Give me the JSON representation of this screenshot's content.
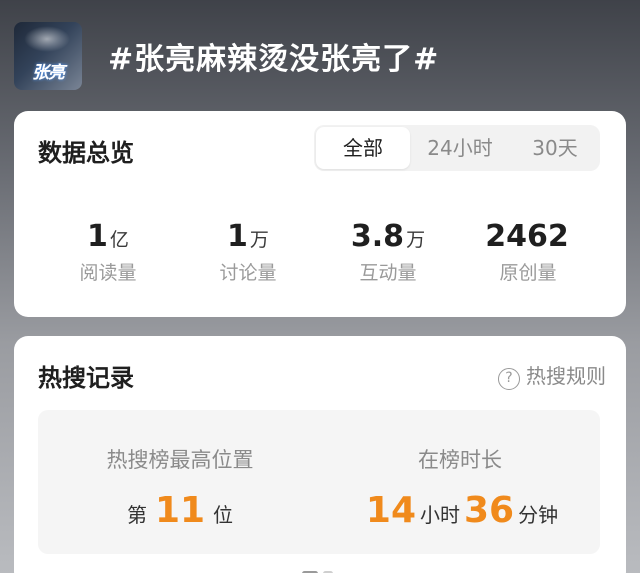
{
  "header": {
    "thumbnail_text": "张亮",
    "topic_title": "#张亮麻辣烫没张亮了#"
  },
  "overview": {
    "title": "数据总览",
    "tabs": [
      {
        "label": "全部",
        "active": true
      },
      {
        "label": "24小时",
        "active": false
      },
      {
        "label": "30天",
        "active": false
      }
    ],
    "stats": [
      {
        "value": "1",
        "unit": "亿",
        "label": "阅读量"
      },
      {
        "value": "1",
        "unit": "万",
        "label": "讨论量"
      },
      {
        "value": "3.8",
        "unit": "万",
        "label": "互动量"
      },
      {
        "value": "2462",
        "unit": "",
        "label": "原创量"
      }
    ]
  },
  "hot_search": {
    "title": "热搜记录",
    "rules_label": "热搜规则",
    "rules_icon": "question-circle-icon",
    "peak": {
      "label": "热搜榜最高位置",
      "prefix": "第",
      "value": "11",
      "suffix": "位"
    },
    "duration": {
      "label": "在榜时长",
      "hours": "14",
      "hours_unit": "小时",
      "minutes": "36",
      "minutes_unit": "分钟"
    }
  },
  "colors": {
    "accent": "#f08a1c",
    "card_bg": "#ffffff",
    "muted_text": "#9a9a9a"
  }
}
